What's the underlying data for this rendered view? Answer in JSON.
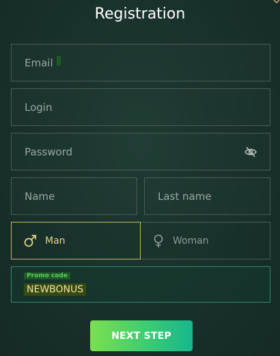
{
  "form": {
    "title": "Registration",
    "email_placeholder": "Email",
    "login_placeholder": "Login",
    "password_placeholder": "Password",
    "name_placeholder": "Name",
    "lastname_placeholder": "Last name",
    "gender": {
      "man_label": "Man",
      "woman_label": "Woman",
      "selected": "Man"
    },
    "promo": {
      "label": "Promo code",
      "value": "NEWBONUS"
    },
    "next_label": "NEXT STEP"
  },
  "colors": {
    "background": "#18302a",
    "accent_gold": "#c9b665",
    "promo_border": "#2e8a72",
    "button_start": "#7be04f",
    "button_end": "#17b68e"
  },
  "icons": {
    "password_toggle": "eye-slash-icon",
    "man": "male-symbol-icon",
    "woman": "female-symbol-icon"
  }
}
